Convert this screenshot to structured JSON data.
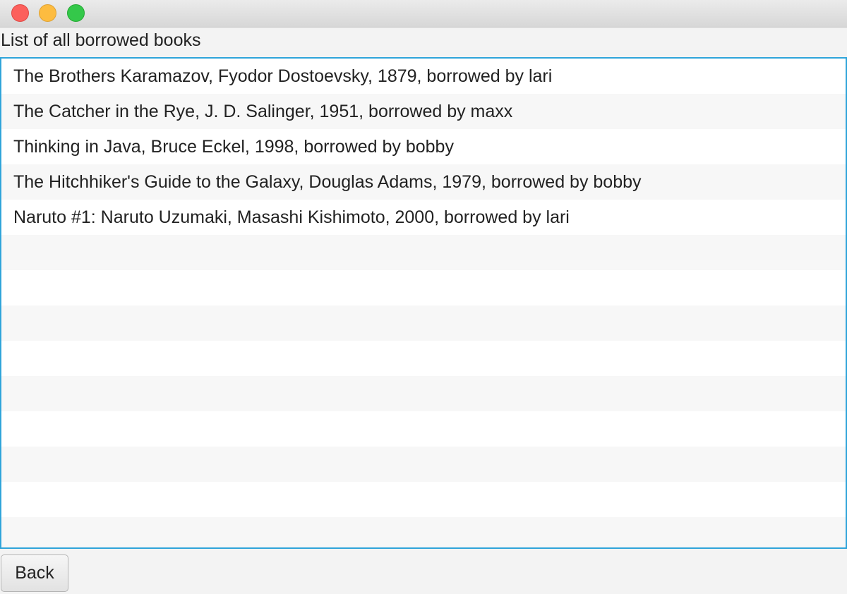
{
  "window": {
    "controls": [
      "close",
      "minimize",
      "zoom"
    ]
  },
  "heading": "List of all borrowed books",
  "borrowed_books": [
    "The Brothers Karamazov, Fyodor Dostoevsky, 1879, borrowed by lari",
    "The Catcher in the Rye, J. D. Salinger, 1951, borrowed by maxx",
    "Thinking in Java, Bruce Eckel, 1998, borrowed by bobby",
    "The Hitchhiker's Guide to the Galaxy, Douglas Adams, 1979, borrowed by bobby",
    "Naruto #1: Naruto Uzumaki, Masashi Kishimoto, 2000, borrowed by lari",
    "",
    "",
    "",
    "",
    "",
    "",
    "",
    "",
    ""
  ],
  "back_button": "Back",
  "colors": {
    "focus_border": "#2fa4da",
    "close": "#fc605c",
    "minimize": "#fdbc40",
    "zoom": "#34c84a"
  }
}
